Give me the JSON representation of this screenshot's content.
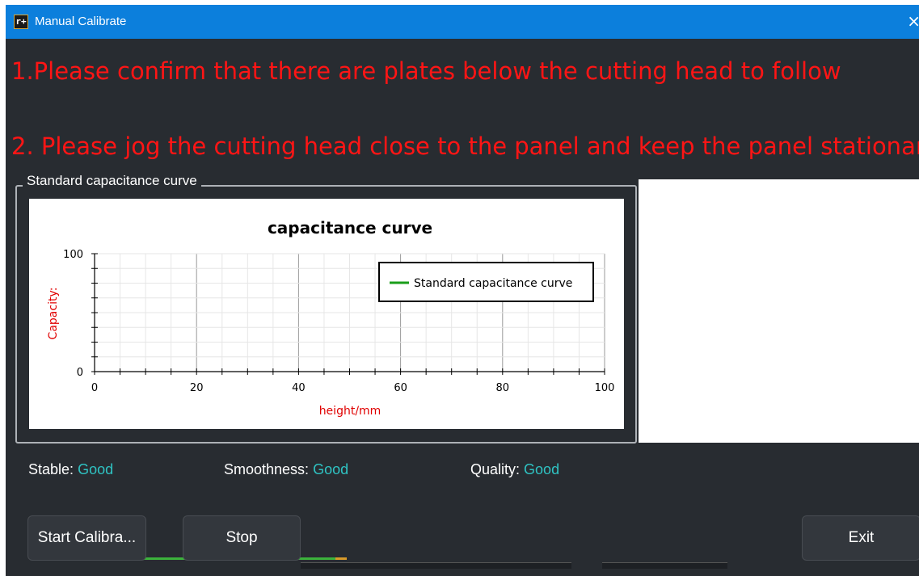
{
  "window": {
    "title": "Manual Calibrate",
    "close_glyph": "×",
    "app_icon_glyph": "r+",
    "icons": [
      "app-icon",
      "close-icon"
    ]
  },
  "instructions": {
    "line1": "1.Please confirm that there are plates below the cutting head to follow",
    "line2": "2. Please jog the cutting head close to the panel and keep the panel stationar..."
  },
  "groupbox": {
    "title": "Standard capacitance curve"
  },
  "chart_data": {
    "type": "line",
    "title": "capacitance curve",
    "xlabel": "height/mm",
    "ylabel": "Capacity:",
    "xlim": [
      0,
      100
    ],
    "ylim": [
      0,
      100
    ],
    "x_ticks": [
      "0",
      "20",
      "40",
      "60",
      "80",
      "100"
    ],
    "y_ticks": [
      "0",
      "100"
    ],
    "grid": true,
    "legend_position": "top-right",
    "series": [
      {
        "name": "Standard capacitance curve",
        "color": "#1a9e1a",
        "x": [],
        "y": []
      }
    ]
  },
  "status": {
    "stable_label": "Stable:",
    "stable_value": "Good",
    "smoothness_label": "Smoothness:",
    "smoothness_value": "Good",
    "quality_label": "Quality:",
    "quality_value": "Good"
  },
  "buttons": {
    "start": "Start Calibra...",
    "stop": "Stop",
    "exit": "Exit"
  },
  "colors": {
    "titlebar": "#0c7fdc",
    "background": "#282c31",
    "instruction_text": "#ff1515",
    "status_value": "#2fc3c3",
    "axis_label": "#e00000"
  }
}
